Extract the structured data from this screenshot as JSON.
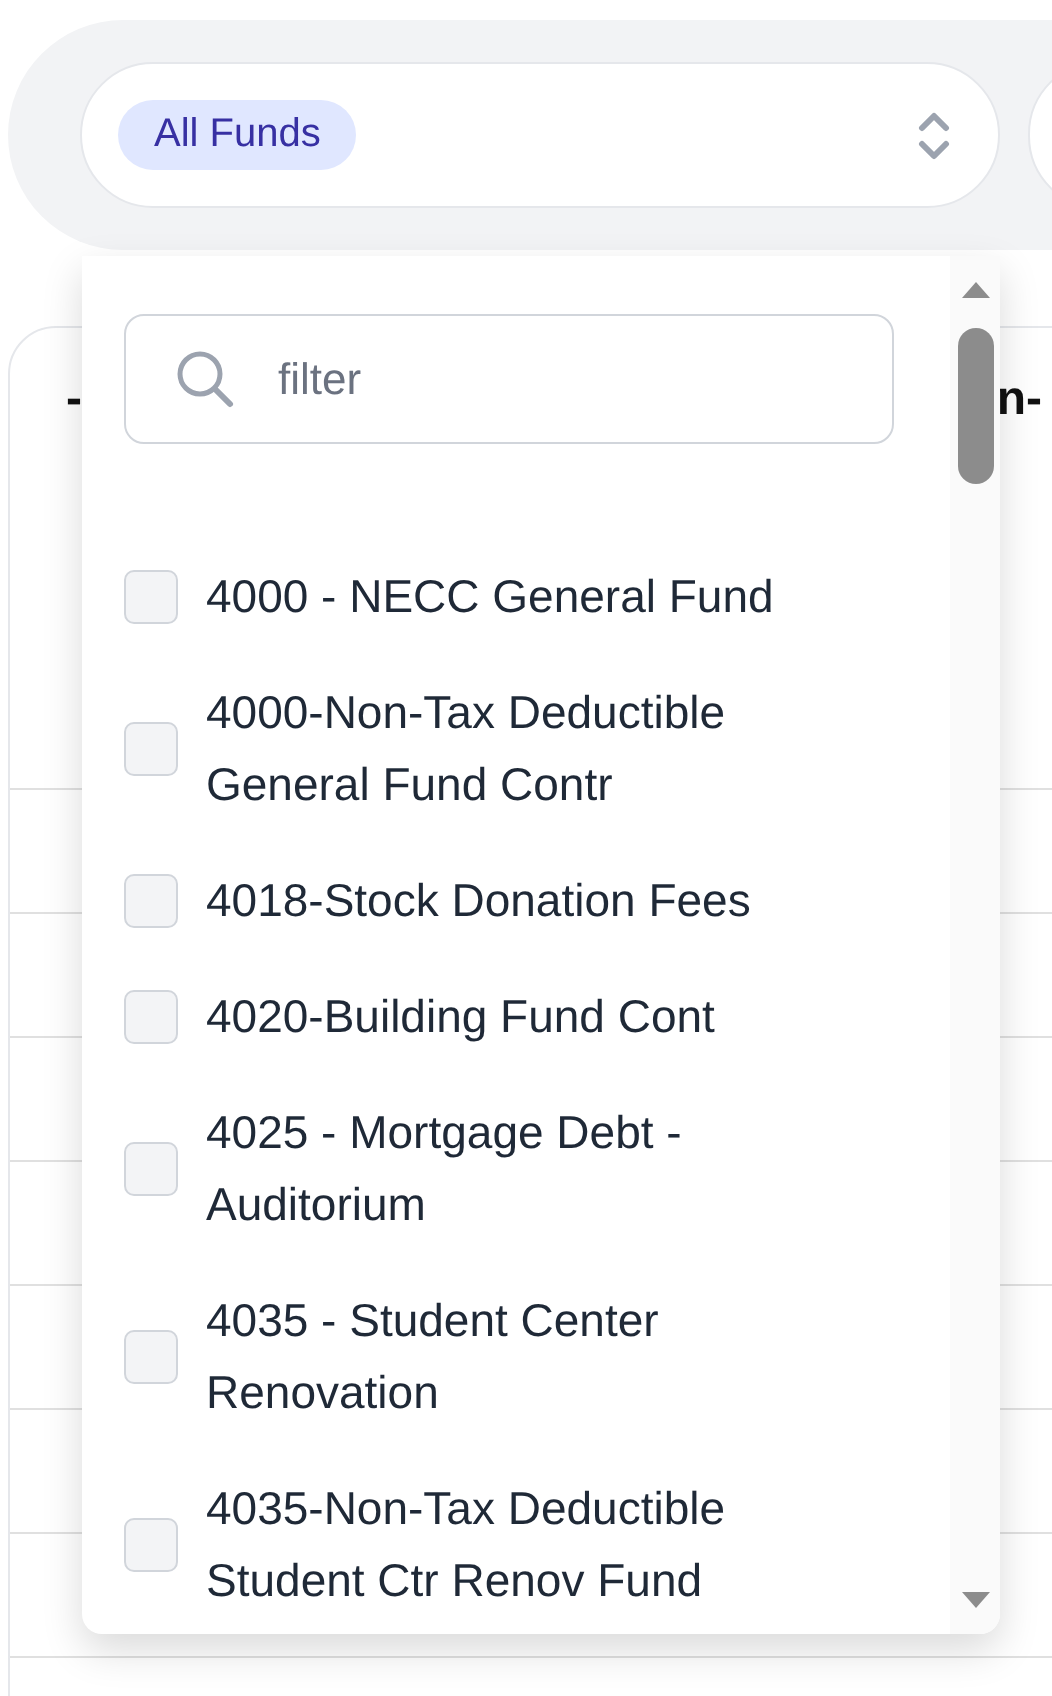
{
  "fund_select": {
    "chip": "All Funds"
  },
  "card": {
    "heading_fragments": [
      "-",
      "n-"
    ]
  },
  "dropdown": {
    "search": {
      "placeholder": "filter"
    },
    "options": [
      {
        "label": "4000 - NECC General Fund",
        "checked": false
      },
      {
        "label": "4000-Non-Tax Deductible General Fund Contr",
        "checked": false
      },
      {
        "label": "4018-Stock Donation Fees",
        "checked": false
      },
      {
        "label": "4020-Building Fund Cont",
        "checked": false
      },
      {
        "label": "4025 - Mortgage Debt - Auditorium",
        "checked": false
      },
      {
        "label": "4035 - Student Center Renovation",
        "checked": false
      },
      {
        "label": "4035-Non-Tax Deductible Student Ctr Renov Fund",
        "checked": false
      }
    ]
  }
}
